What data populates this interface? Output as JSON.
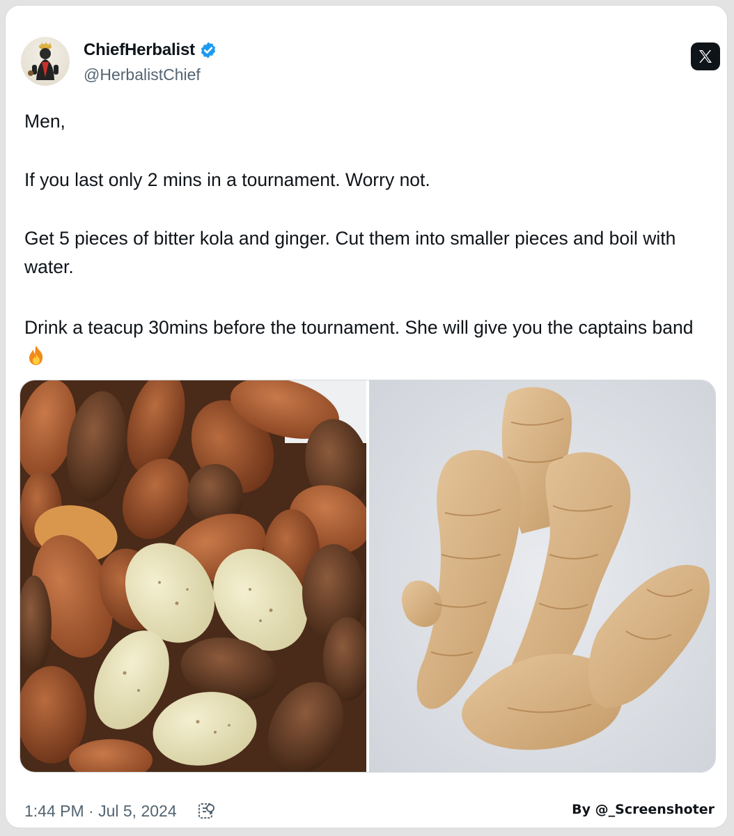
{
  "author": {
    "display_name": "ChiefHerbalist",
    "handle": "@HerbalistChief",
    "verified": true,
    "badge_color": "#1d9bf0"
  },
  "tweet": {
    "lines": [
      "Men,",
      "If you last only 2 mins in a tournament. Worry not.",
      "Get 5 pieces of bitter kola and ginger. Cut them into smaller pieces and boil with water.",
      "Drink a teacup 30mins before the tournament.  She will give you the captains band"
    ],
    "emoji": "fire-icon"
  },
  "media": {
    "left_image": "bitter-kola-photo",
    "right_image": "ginger-root-photo"
  },
  "footer": {
    "timestamp": "1:44 PM · Jul 5, 2024",
    "views_icon": "analytics-icon"
  },
  "watermark": {
    "text": "By @_Screenshoter"
  },
  "platform": {
    "logo": "x-logo-icon"
  }
}
